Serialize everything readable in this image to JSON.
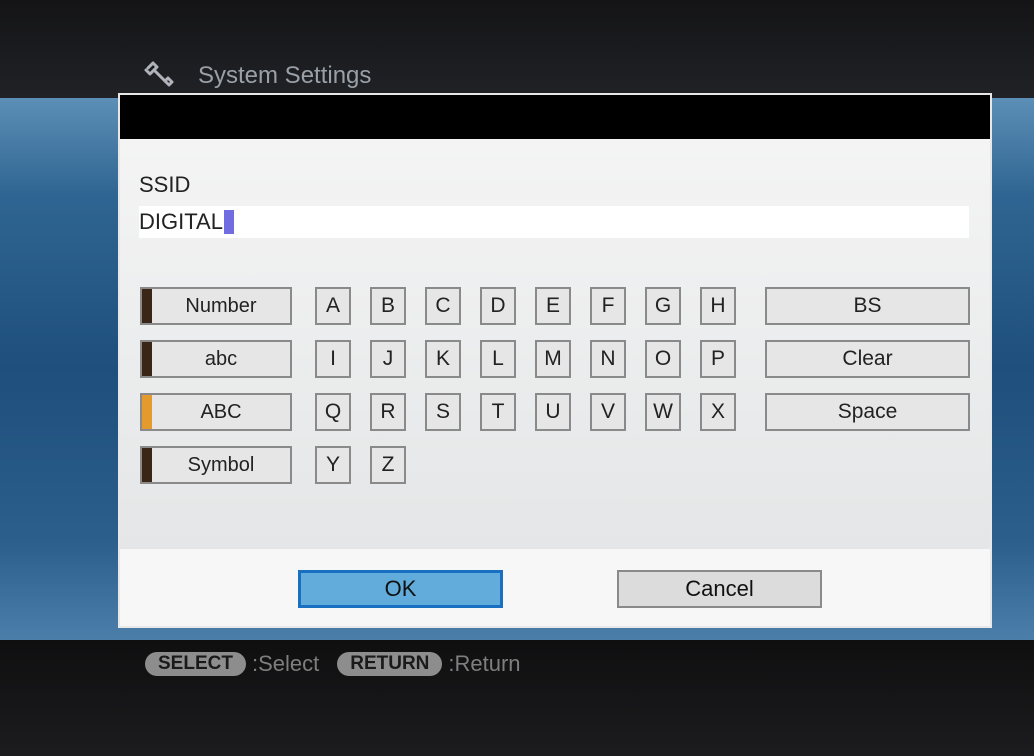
{
  "header": {
    "title": "System Settings",
    "icon": "wrench-icon"
  },
  "dialog": {
    "field_label": "SSID",
    "field_value": "DIGITAL",
    "modes": [
      {
        "label": "Number",
        "active": false
      },
      {
        "label": "abc",
        "active": false
      },
      {
        "label": "ABC",
        "active": true
      },
      {
        "label": "Symbol",
        "active": false
      }
    ],
    "keys": [
      "A",
      "B",
      "C",
      "D",
      "E",
      "F",
      "G",
      "H",
      "I",
      "J",
      "K",
      "L",
      "M",
      "N",
      "O",
      "P",
      "Q",
      "R",
      "S",
      "T",
      "U",
      "V",
      "W",
      "X",
      "Y",
      "Z"
    ],
    "actions": [
      "BS",
      "Clear",
      "Space"
    ],
    "ok_label": "OK",
    "cancel_label": "Cancel"
  },
  "hints": [
    {
      "key": "SELECT",
      "label": ":Select"
    },
    {
      "key": "RETURN",
      "label": ":Return"
    }
  ],
  "colors": {
    "accent": "#62acdc",
    "active_mode": "#e59a2e",
    "cursor": "#6f6de0"
  }
}
